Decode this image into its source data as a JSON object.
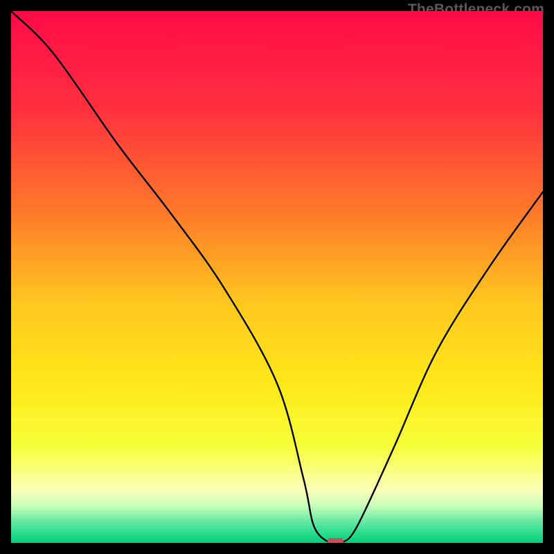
{
  "attribution": "TheBottleneck.com",
  "chart_data": {
    "type": "line",
    "title": "",
    "xlabel": "",
    "ylabel": "",
    "xlim": [
      0,
      100
    ],
    "ylim": [
      0,
      100
    ],
    "x": [
      0,
      8,
      20,
      30,
      40,
      50,
      55,
      57,
      60,
      62,
      65,
      72,
      80,
      90,
      100
    ],
    "values": [
      100,
      92,
      75,
      62,
      48,
      30,
      12,
      3,
      0,
      0,
      3,
      18,
      36,
      52,
      66
    ],
    "minimum_marker": {
      "x": 61,
      "y": 0,
      "width": 3,
      "color": "#c94f55"
    },
    "gradient_stops": [
      {
        "offset": 0.0,
        "color": "#ff0b47"
      },
      {
        "offset": 0.18,
        "color": "#ff2f3f"
      },
      {
        "offset": 0.38,
        "color": "#ff7a2a"
      },
      {
        "offset": 0.55,
        "color": "#ffc81e"
      },
      {
        "offset": 0.7,
        "color": "#ffe81a"
      },
      {
        "offset": 0.82,
        "color": "#f6ff3a"
      },
      {
        "offset": 0.9,
        "color": "#fdffba"
      },
      {
        "offset": 0.93,
        "color": "#c8ffb8"
      },
      {
        "offset": 0.965,
        "color": "#55e6a0"
      },
      {
        "offset": 1.0,
        "color": "#00d07a"
      }
    ]
  }
}
